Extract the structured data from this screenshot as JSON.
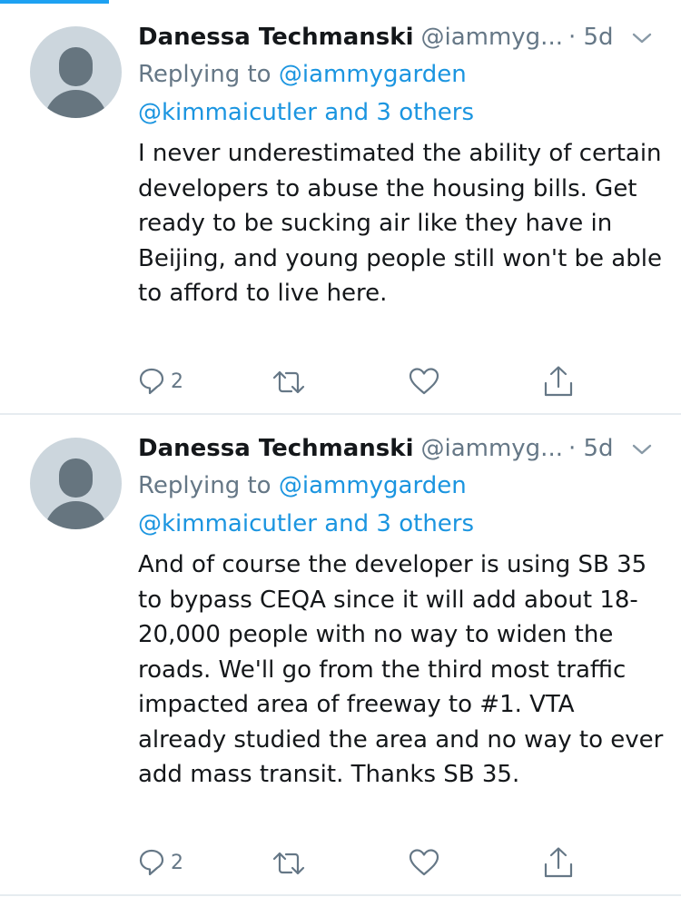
{
  "tweets": [
    {
      "author_name": "Danessa Techmanski",
      "author_handle": "@iammyg...",
      "timestamp": "· 5d",
      "replying_prefix": "Replying to",
      "replying_to": "@iammygarden",
      "replying_others": "@kimmaicutler and 3 others",
      "text": "I never underestimated the ability of certain developers to abuse the housing bills. Get ready to be sucking air like they have in Beijing, and young people still won't be able to afford to live here.",
      "reply_count": "2"
    },
    {
      "author_name": "Danessa Techmanski",
      "author_handle": "@iammyg...",
      "timestamp": "· 5d",
      "replying_prefix": "Replying to",
      "replying_to": "@iammygarden",
      "replying_others": "@kimmaicutler and 3 others",
      "text": "And of course the developer is using SB 35 to bypass CEQA since it will add about 18-20,000 people with no way to widen the roads. We'll go from the third most traffic impacted area of freeway to #1. VTA already studied the area and no way to ever add mass transit. Thanks SB 35.",
      "reply_count": "2"
    }
  ],
  "colors": {
    "accent": "#1da1f2",
    "link": "#1b95e0",
    "secondary_text": "#657786",
    "divider": "#e6ecf0",
    "avatar_bg": "#ccd6dd",
    "avatar_fg": "#66757f"
  },
  "icons": [
    "avatar-placeholder-icon",
    "chevron-down-icon",
    "reply-icon",
    "retweet-icon",
    "like-icon",
    "share-icon"
  ]
}
